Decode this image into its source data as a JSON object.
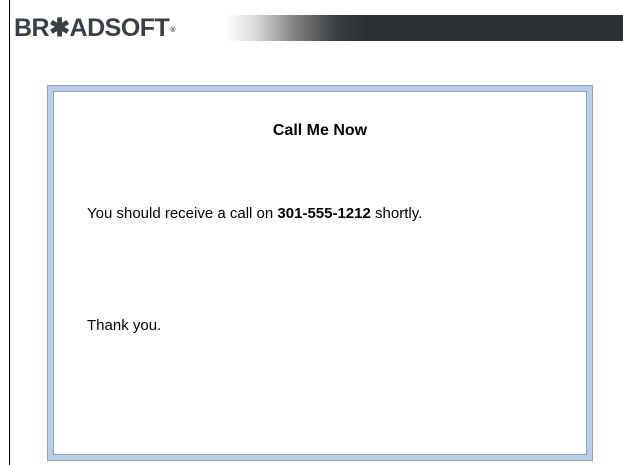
{
  "header": {
    "logo_text": "BR✱ADSOFT",
    "logo_tm": "®",
    "colors": {
      "logo": "#3a3f45",
      "bar_dark": "#2c3035"
    }
  },
  "dialog": {
    "title": "Call Me Now",
    "message_prefix": "You should receive a call on ",
    "phone_number": "301-555-1212",
    "message_suffix": " shortly.",
    "thanks": "Thank you.",
    "colors": {
      "frame": "#bccee6",
      "border": "#8aa2c8"
    }
  }
}
